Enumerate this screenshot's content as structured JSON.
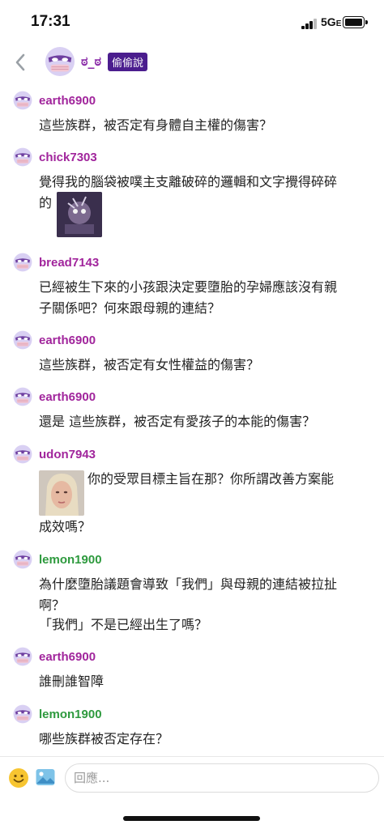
{
  "status_bar": {
    "time": "17:31",
    "network": "5G",
    "network_suffix": "E"
  },
  "header": {
    "board_emoji": "ಠ_ಠ",
    "board_badge": "偷偷說"
  },
  "comments": [
    {
      "user": "earth6900",
      "text": "這些族群，被否定有身體自主權的傷害？"
    },
    {
      "user": "chick7303",
      "text": "覺得我的腦袋被噗主支離破碎的邏輯和文字攪得碎碎",
      "text2": "的"
    },
    {
      "user": "bread7143",
      "text": "已經被生下來的小孩跟決定要墮胎的孕婦應該沒有親",
      "text2": "子關係吧？何來跟母親的連結？"
    },
    {
      "user": "earth6900",
      "text": "這些族群，被否定有女性權益的傷害？"
    },
    {
      "user": "earth6900",
      "text": "還是 這些族群，被否定有愛孩子的本能的傷害？"
    },
    {
      "user": "udon7943",
      "text": "你的受眾目標主旨在那？你所謂改善方案能",
      "text2": "成效嗎？"
    },
    {
      "user": "lemon1900",
      "text": "為什麼墮胎議題會導致「我們」與母親的連結被拉扯",
      "text2": "啊？",
      "text3": "「我們」不是已經出生了嗎？"
    },
    {
      "user": "earth6900",
      "text": "誰刪誰智障"
    },
    {
      "user": "lemon1900",
      "text": "哪些族群被否定存在？"
    }
  ],
  "composer": {
    "placeholder": "回應..."
  },
  "colors": {
    "username_purple": "#a1259c",
    "username_green": "#2e9a3e",
    "badge": "#4b1d8e"
  },
  "icons": [
    "chevron-left-icon",
    "masked-avatar-icon",
    "emoji-icon",
    "image-icon"
  ]
}
